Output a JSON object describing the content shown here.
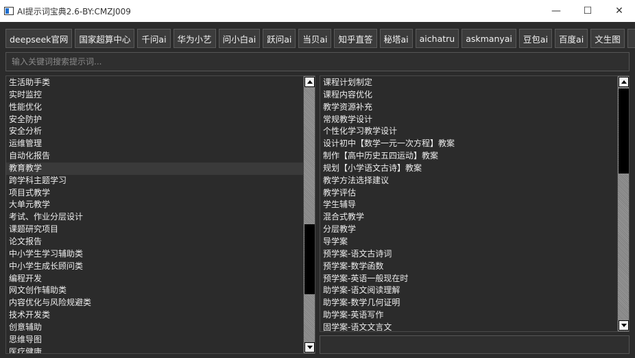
{
  "window": {
    "title": "AI提示词宝典2.6-BY:CMZJ009",
    "minimize": "—",
    "maximize": "☐",
    "close": "✕"
  },
  "toolbar": {
    "buttons": [
      "deepseek官网",
      "国家超算中心",
      "千问ai",
      "华为小艺",
      "问小白ai",
      "跃问ai",
      "当贝ai",
      "知乎直答",
      "秘塔ai",
      "aichatru",
      "askmanyai",
      "豆包ai",
      "百度ai",
      "文生图"
    ],
    "add_label": "+"
  },
  "search": {
    "placeholder": "输入关键词搜索提示词..."
  },
  "categories": {
    "items": [
      "生活助手类",
      "实时监控",
      "性能优化",
      "安全防护",
      "安全分析",
      "运维管理",
      "自动化报告",
      "教育教学",
      "跨学科主题学习",
      "项目式教学",
      "大单元教学",
      "考试、作业分层设计",
      "课题研究项目",
      "论文报告",
      "中小学生学习辅助类",
      "中小学生成长顾问类",
      "编程开发",
      "网文创作辅助类",
      "内容优化与风险规避类",
      "技术开发类",
      "创意辅助",
      "思维导图",
      "医疗健康"
    ],
    "selected_index": 7
  },
  "prompts": {
    "items": [
      "课程计划制定",
      "课程内容优化",
      "教学资源补充",
      "常规教学设计",
      "个性化学习教学设计",
      "设计初中【数学一元一次方程】教案",
      "制作【高中历史五四运动】教案",
      "规划【小学语文古诗】教案",
      "教学方法选择建议",
      "教学评估",
      "学生辅导",
      "混合式教学",
      "分层教学",
      "导学案",
      "预学案-语文古诗词",
      "预学案-数学函数",
      "预学案-英语一般现在时",
      "助学案-语文阅读理解",
      "助学案-数学几何证明",
      "助学案-英语写作",
      "固学案-语文文言文"
    ]
  }
}
